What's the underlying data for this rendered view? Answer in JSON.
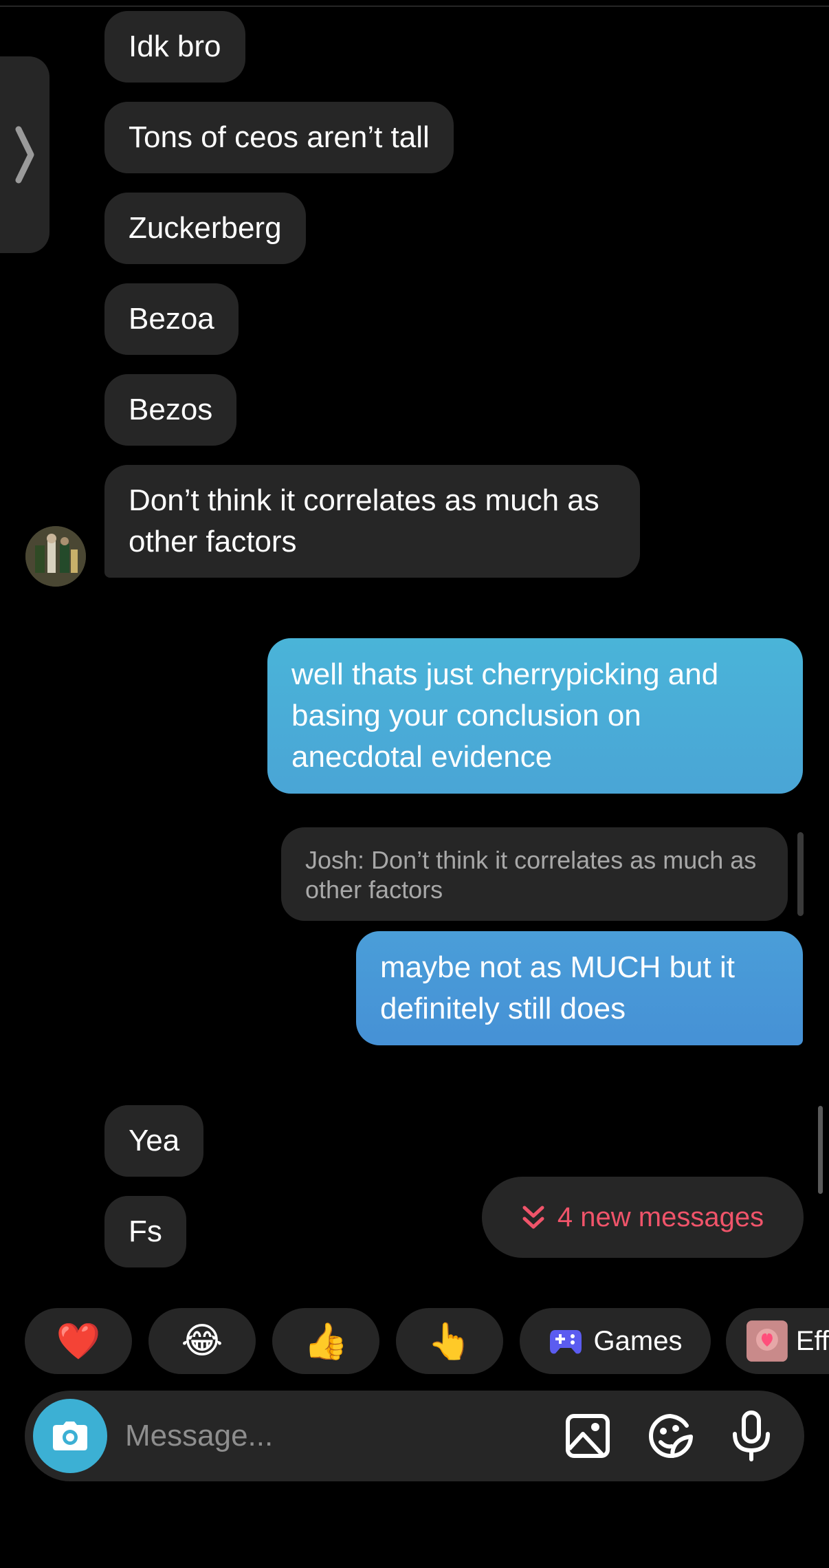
{
  "messages_in_top": [
    "Idk bro",
    "Tons of ceos aren’t tall",
    "Zuckerberg",
    "Bezoa",
    "Bezos",
    "Don’t think it correlates as much as other factors"
  ],
  "messages_out": [
    "well thats just cherrypicking and basing your conclusion on anecdotal evidence",
    "maybe not as MUCH but it definitely still does"
  ],
  "reply_preview": "Josh: Don’t think it correlates as much as other factors",
  "messages_in_bottom": [
    "Yea",
    "Fs"
  ],
  "new_messages": "4 new messages",
  "quick_reactions": [
    {
      "icon": "heart-emoji",
      "glyph": "❤️"
    },
    {
      "icon": "laughing-tears-emoji",
      "glyph": "😂"
    },
    {
      "icon": "thumbs-up-emoji",
      "glyph": "👍"
    },
    {
      "icon": "pointing-hand-emoji",
      "glyph": "👆"
    }
  ],
  "games_label": "Games",
  "effects_label": "Eff",
  "composer": {
    "placeholder": "Message..."
  },
  "colors": {
    "incoming_bubble": "#262626",
    "outgoing_gradient_top": "#4ab4d8",
    "outgoing_gradient_bottom": "#4691d6",
    "new_messages_text": "#f0546a",
    "camera_button": "#3cb0d4",
    "background": "#000000"
  }
}
